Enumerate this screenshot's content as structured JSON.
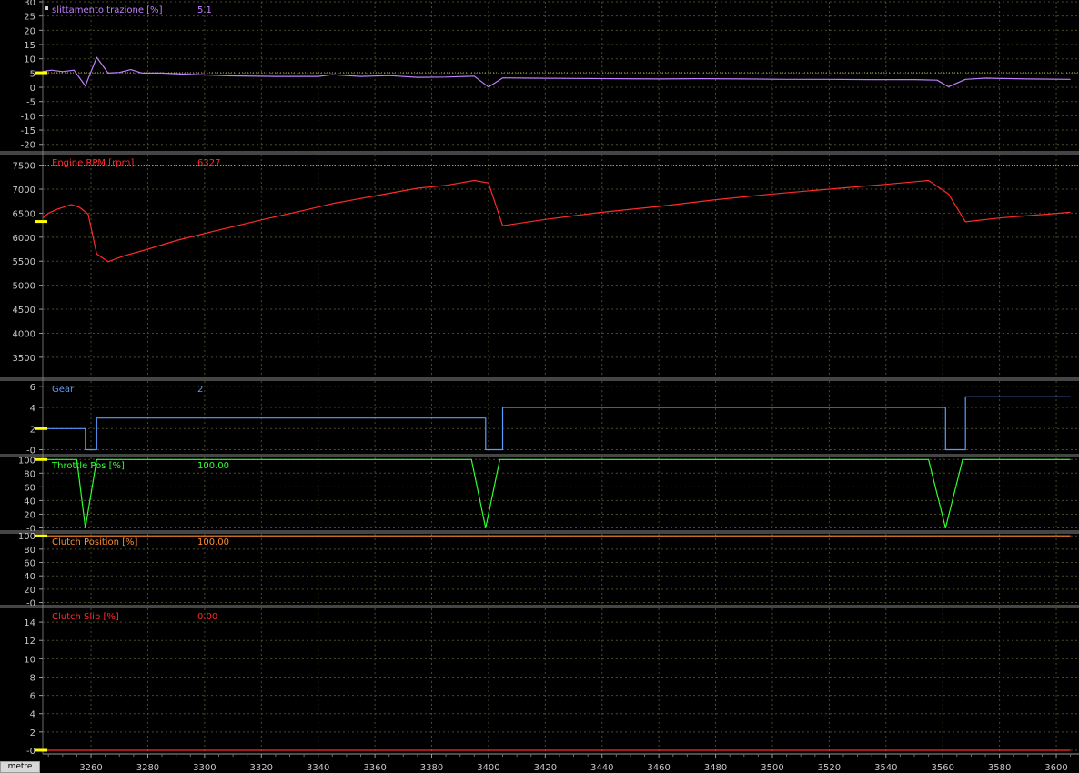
{
  "colors": {
    "background": "#000000",
    "grid": "#4a4a2a",
    "axis_text": "#c8c8c8",
    "marker": "#ffff00",
    "separator": "#8a8a8a"
  },
  "x_axis_unit": "metre",
  "chart_data": [
    {
      "type": "line",
      "label": "slittamento trazione [%]",
      "cursor_value": "5.1",
      "color": "#c080ff",
      "ylim": [
        -22,
        30
      ],
      "yticks": [
        30,
        25,
        20,
        15,
        10,
        5,
        0,
        -5,
        -10,
        -15,
        -20
      ],
      "ytick_labels": [
        "30",
        "25",
        "20",
        "15",
        "10",
        "5",
        "0",
        "-5",
        "-10",
        "-15",
        "-20"
      ],
      "reference_line": 5.1,
      "x": [
        3243,
        3246,
        3250,
        3254,
        3258,
        3262,
        3266,
        3270,
        3274,
        3278,
        3285,
        3295,
        3310,
        3325,
        3340,
        3345,
        3355,
        3365,
        3375,
        3385,
        3395,
        3400,
        3405,
        3415,
        3430,
        3445,
        3460,
        3475,
        3490,
        3505,
        3520,
        3535,
        3550,
        3558,
        3562,
        3568,
        3575,
        3590,
        3605
      ],
      "values": [
        5.5,
        6.0,
        5.5,
        6.0,
        0.5,
        10.5,
        5.0,
        5.2,
        6.2,
        5.0,
        5.0,
        4.5,
        4.0,
        3.8,
        3.8,
        4.4,
        3.8,
        4.1,
        3.5,
        3.6,
        3.9,
        0.1,
        3.3,
        3.2,
        3.1,
        3.0,
        2.9,
        3.0,
        2.9,
        2.8,
        2.8,
        2.7,
        2.7,
        2.5,
        0.2,
        2.8,
        3.2,
        2.9,
        2.8
      ]
    },
    {
      "type": "line",
      "label": "Engine RPM [rpm]",
      "cursor_value": "6327",
      "color": "#ff2a2a",
      "ylim": [
        3100,
        7720
      ],
      "yticks": [
        7500,
        7000,
        6500,
        6000,
        5500,
        5000,
        4500,
        4000,
        3500
      ],
      "ytick_labels": [
        "7500",
        "7000",
        "6500",
        "6000",
        "5500",
        "5000",
        "4500",
        "4000",
        "3500"
      ],
      "reference_line": 7500,
      "x": [
        3243,
        3245,
        3248,
        3253,
        3256,
        3259,
        3262,
        3266,
        3272,
        3280,
        3290,
        3305,
        3320,
        3335,
        3345,
        3360,
        3375,
        3385,
        3395,
        3400,
        3405,
        3420,
        3440,
        3460,
        3480,
        3500,
        3520,
        3540,
        3555,
        3562,
        3568,
        3580,
        3605
      ],
      "values": [
        6400,
        6500,
        6580,
        6680,
        6620,
        6480,
        5650,
        5490,
        5620,
        5750,
        5930,
        6150,
        6360,
        6560,
        6700,
        6860,
        7020,
        7080,
        7180,
        7130,
        6240,
        6370,
        6520,
        6640,
        6780,
        6900,
        7000,
        7100,
        7180,
        6900,
        6320,
        6400,
        6520
      ]
    },
    {
      "type": "line",
      "label": "Gear",
      "cursor_value": "2",
      "color": "#5a9aff",
      "ylim": [
        -0.3,
        6.5
      ],
      "yticks": [
        6,
        4,
        2,
        0
      ],
      "ytick_labels": [
        "6",
        "4",
        "2",
        "-0"
      ],
      "x": [
        3243,
        3258,
        3258,
        3262,
        3262,
        3399,
        3399,
        3405,
        3405,
        3561,
        3561,
        3568,
        3568,
        3605
      ],
      "values": [
        2,
        2,
        0,
        0,
        3,
        3,
        0,
        0,
        4,
        4,
        0,
        0,
        5,
        5
      ]
    },
    {
      "type": "line",
      "label": "Throttle Pos [%]",
      "cursor_value": "100.00",
      "color": "#30ff30",
      "ylim": [
        -2,
        103
      ],
      "yticks": [
        100,
        80,
        60,
        40,
        20,
        0
      ],
      "ytick_labels": [
        "100",
        "80",
        "60",
        "40",
        "20",
        "-0"
      ],
      "x": [
        3243,
        3255,
        3258,
        3262,
        3394,
        3399,
        3404,
        3555,
        3561,
        3567,
        3605
      ],
      "values": [
        100,
        100,
        0,
        100,
        100,
        0,
        100,
        100,
        0,
        100,
        100
      ]
    },
    {
      "type": "line",
      "label": "Clutch Position [%]",
      "cursor_value": "100.00",
      "color": "#ff8c30",
      "ylim": [
        -2,
        103
      ],
      "yticks": [
        100,
        80,
        60,
        40,
        20,
        0
      ],
      "ytick_labels": [
        "100",
        "80",
        "60",
        "40",
        "20",
        "-0"
      ],
      "x": [
        3243,
        3605
      ],
      "values": [
        100,
        100
      ]
    },
    {
      "type": "line",
      "label": "Clutch Slip [%]",
      "cursor_value": "0.00",
      "color": "#ff2a2a",
      "ylim": [
        -0.3,
        15.5
      ],
      "yticks": [
        14,
        12,
        10,
        8,
        6,
        4,
        2,
        0
      ],
      "ytick_labels": [
        "14",
        "12",
        "10",
        "8",
        "6",
        "4",
        "2",
        "-0"
      ],
      "x": [
        3243,
        3605
      ],
      "values": [
        0,
        0
      ]
    }
  ],
  "x_axis": {
    "xlim": [
      3243,
      3608
    ],
    "ticks": [
      3260,
      3280,
      3300,
      3320,
      3340,
      3360,
      3380,
      3400,
      3420,
      3440,
      3460,
      3480,
      3500,
      3520,
      3540,
      3560,
      3580,
      3600
    ],
    "tick_labels": [
      "3260",
      "3280",
      "3300",
      "3320",
      "3340",
      "3360",
      "3380",
      "3400",
      "3420",
      "3440",
      "3460",
      "3480",
      "3500",
      "3520",
      "3540",
      "3560",
      "3580",
      "3600"
    ]
  }
}
